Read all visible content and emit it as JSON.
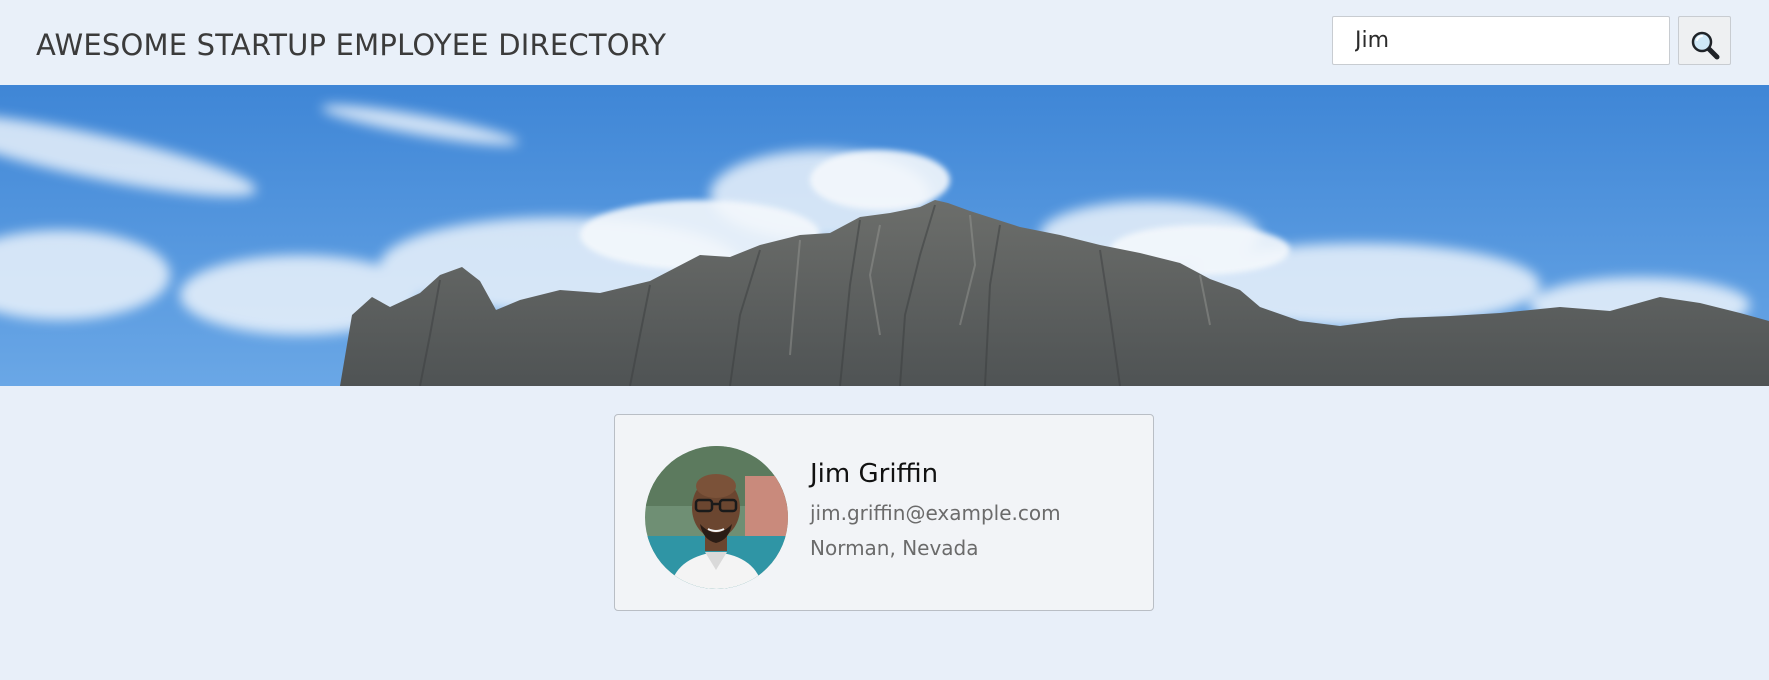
{
  "header": {
    "title": "AWESOME STARTUP EMPLOYEE DIRECTORY"
  },
  "search": {
    "value": "Jim",
    "button_icon": "magnifier-icon"
  },
  "banner": {
    "image": "mountain-banner"
  },
  "employees": [
    {
      "name": "Jim Griffin",
      "email": "jim.griffin@example.com",
      "location": "Norman, Nevada",
      "avatar": "avatar-photo"
    }
  ],
  "colors": {
    "background": "#e8eff9",
    "card_background": "#f2f4f7",
    "card_border": "#b9bec5",
    "title_text": "#3b3b3b",
    "secondary_text": "#6b6b6b"
  }
}
